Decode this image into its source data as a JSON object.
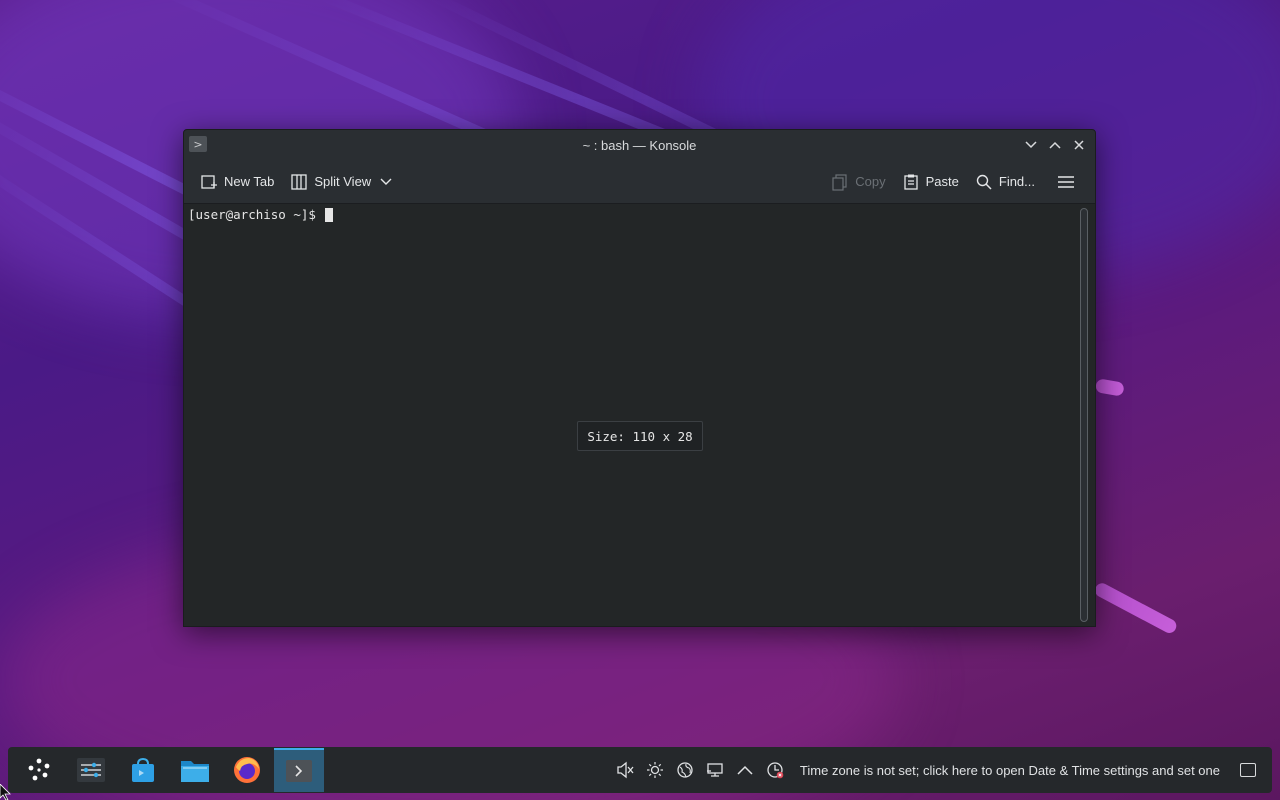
{
  "window": {
    "title": "~ : bash — Konsole",
    "app_icon": "terminal-icon",
    "controls": [
      "minimize",
      "maximize",
      "close"
    ]
  },
  "toolbar": {
    "new_tab_label": "New Tab",
    "split_view_label": "Split View",
    "copy_label": "Copy",
    "paste_label": "Paste",
    "find_label": "Find...",
    "menu_icon": "hamburger-icon"
  },
  "terminal": {
    "prompt": "[user@archiso ~]$",
    "size_overlay": "Size: 110 x 28"
  },
  "taskbar": {
    "apps": [
      "app-launcher",
      "system-settings",
      "discover",
      "dolphin",
      "firefox",
      "konsole"
    ],
    "active_app": "konsole",
    "tray_icons": [
      "volume-muted-icon",
      "brightness-icon",
      "network-icon",
      "display-icon",
      "expand-tray-icon",
      "clock-alert-icon"
    ],
    "clock_text": "Time zone is not set; click here to open Date & Time settings and set one"
  },
  "colors": {
    "window_bg": "#232627",
    "titlebar_bg": "#2a2e32",
    "taskbar_bg": "#25282b",
    "accent": "#3daee9"
  }
}
